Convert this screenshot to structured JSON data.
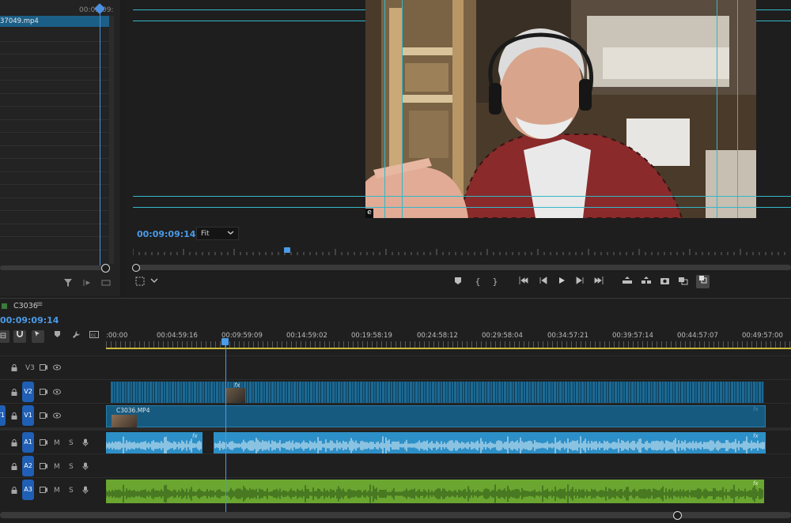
{
  "source_panel": {
    "ruler_time": "00:09:09:",
    "clip_label": "37049.mp4",
    "icons": [
      "filter-icon",
      "insert-icon",
      "overwrite-icon"
    ]
  },
  "program_monitor": {
    "timecode": "00:09:09:14",
    "zoom_select": "Fit",
    "frame_badge": "e",
    "transport": [
      "marker-icon",
      "mark-in-icon",
      "mark-out-icon",
      "go-to-in-icon",
      "step-back-icon",
      "play-icon",
      "step-forward-icon",
      "go-to-out-icon",
      "lift-icon",
      "extract-icon",
      "export-frame-icon",
      "multi-camera-icon",
      "comparison-view-icon"
    ]
  },
  "timeline": {
    "sequence_name": "C3036",
    "timecode": "00:09:09:14",
    "ruler_ticks": [
      ":00:00",
      "00:04:59:16",
      "00:09:59:09",
      "00:14:59:02",
      "00:19:58:19",
      "00:24:58:12",
      "00:29:58:04",
      "00:34:57:21",
      "00:39:57:14",
      "00:44:57:07",
      "00:49:57:00"
    ],
    "tracks": [
      {
        "id": "V3",
        "type": "video"
      },
      {
        "id": "V2",
        "type": "video"
      },
      {
        "id": "V1",
        "type": "video",
        "source_patch": "V1"
      },
      {
        "id": "A1",
        "type": "audio",
        "mute": "M",
        "solo": "S"
      },
      {
        "id": "A2",
        "type": "audio",
        "mute": "M",
        "solo": "S"
      },
      {
        "id": "A3",
        "type": "audio",
        "mute": "M",
        "solo": "S"
      }
    ],
    "clip_v1_label": "C3036.MP4",
    "fx_label": "fx",
    "colors": {
      "video_clip": "#165a80",
      "audio_a1": "#2d8fc7",
      "audio_a3": "#6aa630",
      "playhead": "#4a9be8",
      "track_target": "#1f5fb5"
    }
  }
}
